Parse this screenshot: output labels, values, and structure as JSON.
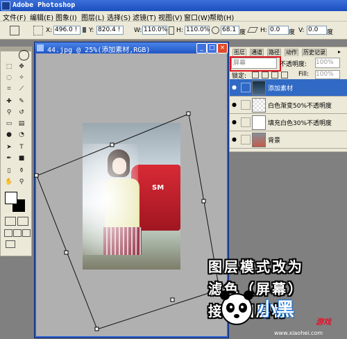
{
  "app": {
    "title": "Adobe Photoshop"
  },
  "menu": [
    "文件(F)",
    "编辑(E)",
    "图象(I)",
    "图层(L)",
    "选择(S)",
    "滤镜(T)",
    "视图(V)",
    "窗口(W)",
    "帮助(H)"
  ],
  "options_bar": {
    "x_label": "X:",
    "x_value": "496.0 !",
    "y_label": "Y:",
    "y_value": "820.4 !",
    "w_label": "W:",
    "w_value": "110.0%",
    "h_label": "H:",
    "h_value": "110.0%",
    "angle_value": "68.1",
    "angle_unit": "度",
    "hskew_label": "H:",
    "hskew_value": "0.0",
    "hskew_unit": "度",
    "vskew_label": "V:",
    "vskew_value": "0.0",
    "vskew_unit": "度"
  },
  "document": {
    "title": "44.jpg @ 25%(添加素材,RGB)",
    "minimize": "_",
    "maximize": "□",
    "close": "×"
  },
  "photo": {
    "car_text": "SM"
  },
  "layers_panel": {
    "tabs": [
      "图层",
      "通道",
      "路径",
      "动作",
      "历史记录"
    ],
    "blend_mode": "屏幕",
    "opacity_label": "不透明度:",
    "opacity_value": "100%",
    "lock_label": "锁定:",
    "fill_label": "Fill:",
    "fill_value": "100%",
    "layers": [
      {
        "name": "添加素材",
        "selected": true
      },
      {
        "name": "白色渐变50%不透明度",
        "selected": false
      },
      {
        "name": "填充白色30%不透明度",
        "selected": false
      },
      {
        "name": "背景",
        "selected": false
      }
    ]
  },
  "caption": {
    "line1": "图层模式改为",
    "line2": "滤色（屏幕）",
    "line3": "接着图层材"
  },
  "watermark": {
    "brand": "小黑",
    "sub": "游戏",
    "url": "www.xiaohei.com"
  }
}
